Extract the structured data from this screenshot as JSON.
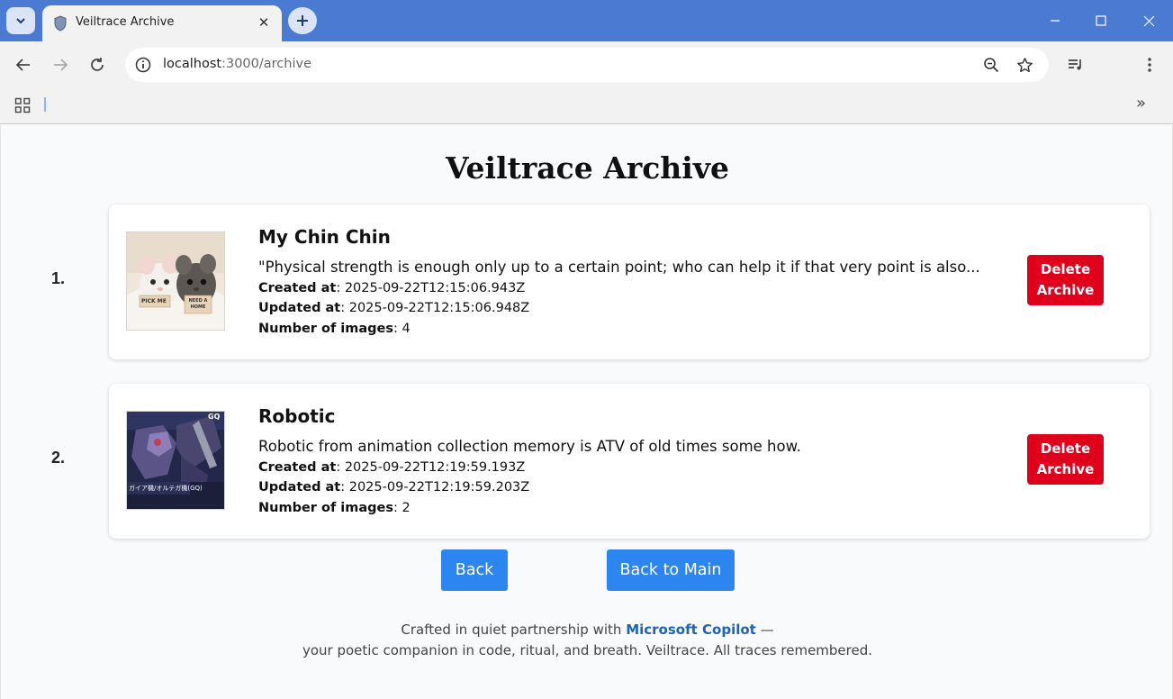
{
  "browser": {
    "tab_title": "Veiltrace Archive",
    "url_host": "localhost",
    "url_path": ":3000/archive"
  },
  "page": {
    "title": "Veiltrace Archive",
    "labels": {
      "created": "Created at",
      "updated": "Updated at",
      "images": "Number of images"
    },
    "archives": [
      {
        "index": "1.",
        "title": "My Chin Chin",
        "description": "\"Physical strength is enough only up to a certain point; who can help it if that very point is also...",
        "created_at": "2025-09-22T12:15:06.943Z",
        "updated_at": "2025-09-22T12:15:06.948Z",
        "image_count": "4",
        "delete_label_1": "Delete",
        "delete_label_2": "Archive",
        "thumb_text_1": "PICK ME",
        "thumb_text_2": "NEED A HOME"
      },
      {
        "index": "2.",
        "title": "Robotic",
        "description": "Robotic from animation collection memory is ATV of old times some how.",
        "created_at": "2025-09-22T12:19:59.193Z",
        "updated_at": "2025-09-22T12:19:59.203Z",
        "image_count": "2",
        "delete_label_1": "Delete",
        "delete_label_2": "Archive",
        "thumb_text_1": "ガイア機/オルテガ機(GQ)",
        "thumb_text_2": "GQ"
      }
    ],
    "back_label": "Back",
    "back_main_label": "Back to Main",
    "footer": {
      "line1_prefix": "Crafted in quiet partnership with",
      "line1_link": "Microsoft Copilot",
      "line1_suffix": "—",
      "line2": "your poetic companion in code, ritual, and breath. Veiltrace. All traces remembered."
    }
  },
  "colors": {
    "titlebar": "#4a7ad2",
    "delete": "#e0001b",
    "primary_button": "#2d86f0",
    "link": "#1d63b8"
  }
}
